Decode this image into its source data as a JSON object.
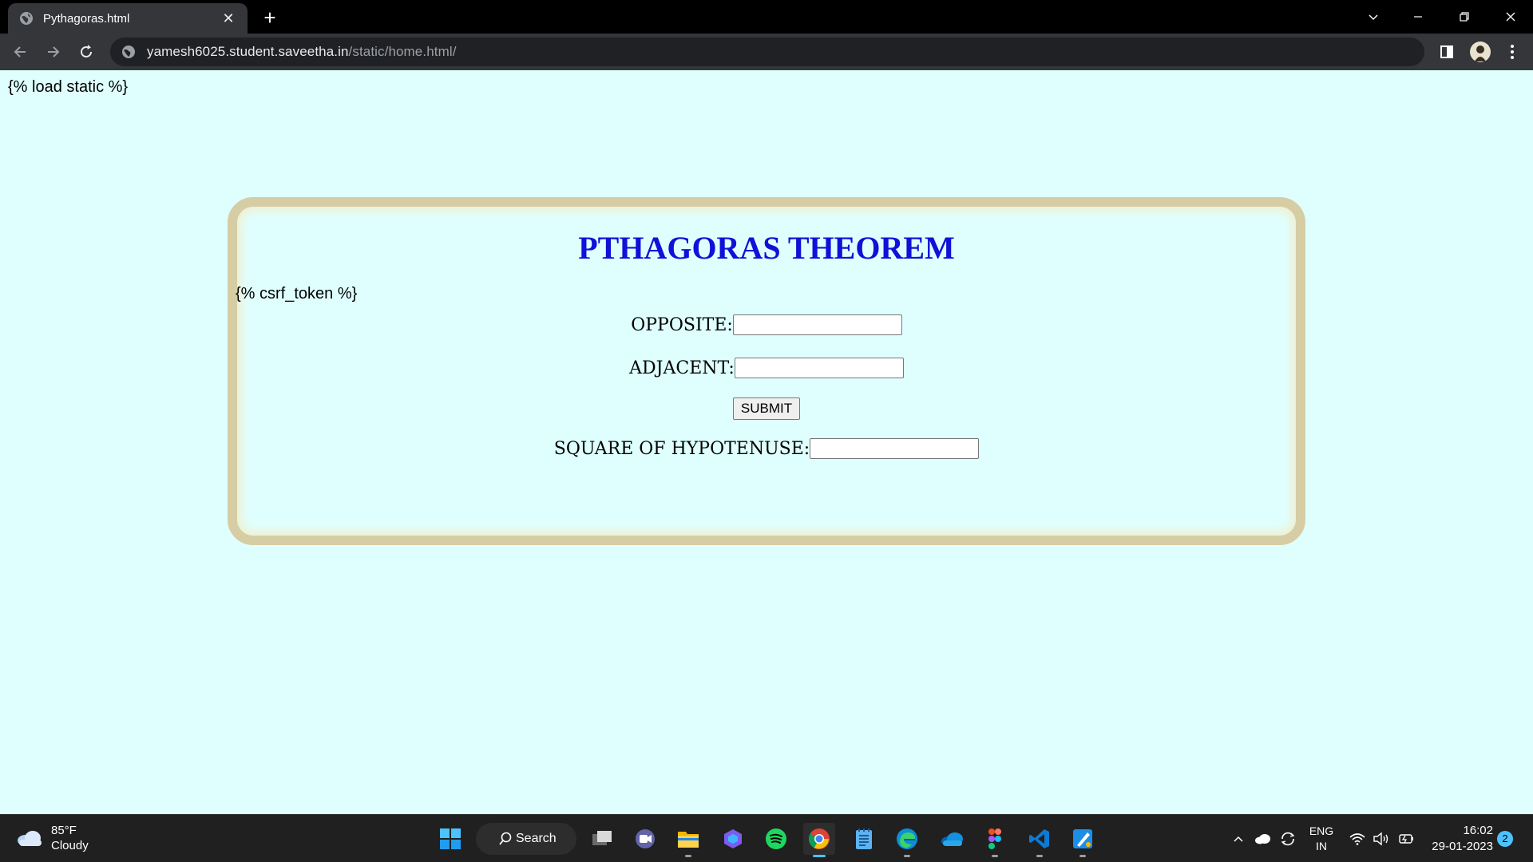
{
  "browser": {
    "tab_title": "Pythagoras.html",
    "tab_close": "✕",
    "new_tab": "+",
    "url_host": "yamesh6025.student.saveetha.in",
    "url_path": "/static/home.html/"
  },
  "page": {
    "load_static": "{% load static %}",
    "heading": "PTHAGORAS THEOREM",
    "csrf": "{% csrf_token %}",
    "opposite_label": "OPPOSITE:",
    "opposite_value": "",
    "adjacent_label": "ADJACENT:",
    "adjacent_value": "",
    "submit_label": "SUBMIT",
    "hypotenuse_label": "SQUARE OF HYPOTENUSE:",
    "hypotenuse_value": ""
  },
  "taskbar": {
    "weather_temp": "85°F",
    "weather_desc": "Cloudy",
    "search_label": "Search",
    "lang_top": "ENG",
    "lang_bottom": "IN",
    "time": "16:02",
    "date": "29-01-2023",
    "notification_count": "2"
  },
  "colors": {
    "page_background": "#dfffff",
    "heading": "#1010d8",
    "card_border": "#d6cda4"
  }
}
